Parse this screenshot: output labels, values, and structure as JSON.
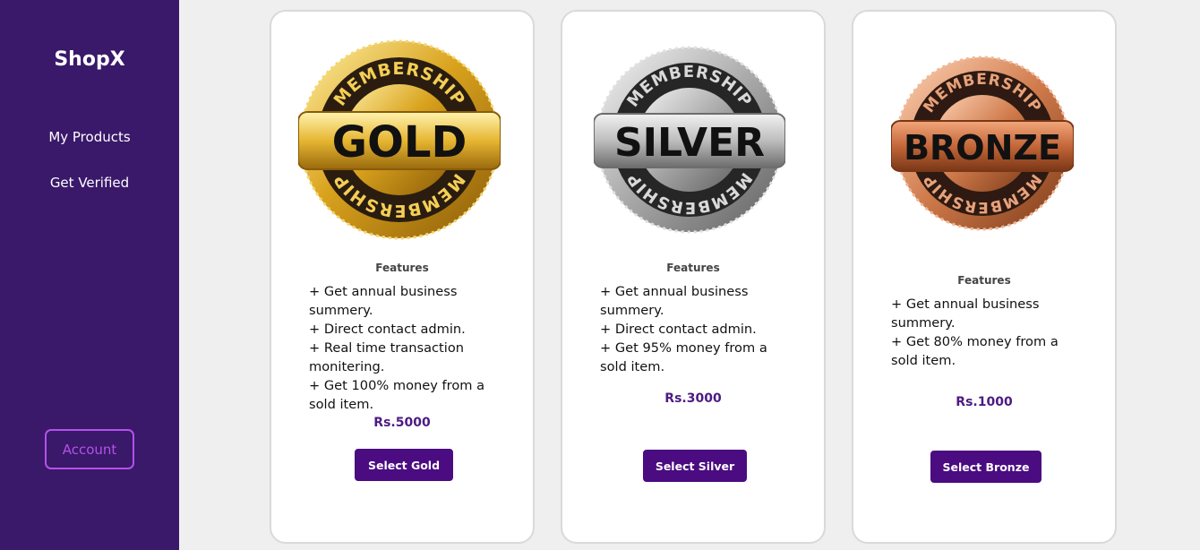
{
  "sidebar": {
    "brand": "ShopX",
    "nav": [
      "My Products",
      "Get Verified"
    ],
    "account_label": "Account"
  },
  "plans": [
    {
      "badge_text": "GOLD",
      "ring_text": "MEMBERSHIP",
      "features_title": "Features",
      "features": [
        "+ Get annual business summery.",
        "+ Direct contact admin.",
        "+ Real time transaction monitering.",
        "+ Get 100% money from a sold item."
      ],
      "price": "Rs.5000",
      "button_label": "Select Gold"
    },
    {
      "badge_text": "SILVER",
      "ring_text": "MEMBERSHIP",
      "features_title": "Features",
      "features": [
        "+ Get annual business summery.",
        "+ Direct contact admin.",
        "+ Get 95% money from a sold item."
      ],
      "price": "Rs.3000",
      "button_label": "Select Silver"
    },
    {
      "badge_text": "BRONZE",
      "ring_text": "MEMBERSHIP",
      "features_title": "Features",
      "features": [
        "+ Get annual business summery.",
        "+ Get 80% money from a sold item."
      ],
      "price": "Rs.1000",
      "button_label": "Select Bronze"
    }
  ],
  "colors": {
    "sidebar_bg": "#3a186a",
    "account_border": "#b352e8",
    "price_text": "#4d1b82",
    "button_bg": "#4a0c80",
    "gold": "#e2b83e",
    "silver": "#bfbfbf",
    "bronze": "#d4845a"
  }
}
